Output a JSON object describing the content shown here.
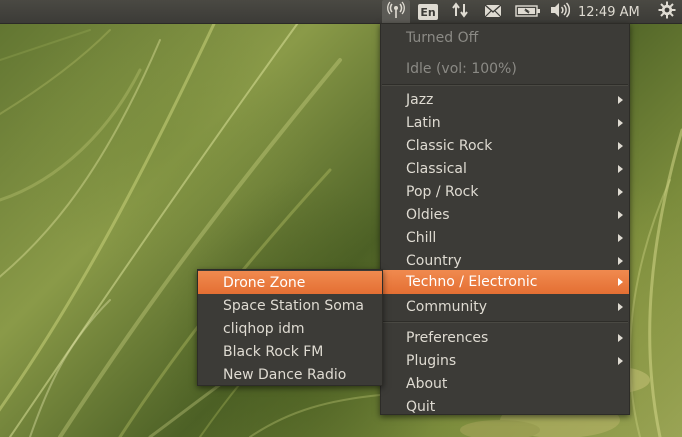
{
  "panel": {
    "language_label": "En",
    "clock": "12:49 AM"
  },
  "radio_menu": {
    "status": "Turned Off",
    "volume_status": "Idle (vol: 100%)",
    "genres": [
      {
        "label": "Jazz",
        "has_submenu": true
      },
      {
        "label": "Latin",
        "has_submenu": true
      },
      {
        "label": "Classic Rock",
        "has_submenu": true
      },
      {
        "label": "Classical",
        "has_submenu": true
      },
      {
        "label": "Pop / Rock",
        "has_submenu": true
      },
      {
        "label": "Oldies",
        "has_submenu": true
      },
      {
        "label": "Chill",
        "has_submenu": true
      },
      {
        "label": "Country",
        "has_submenu": true
      },
      {
        "label": "Techno / Electronic",
        "has_submenu": true,
        "selected": true
      },
      {
        "label": "Community",
        "has_submenu": true
      }
    ],
    "footer": [
      {
        "label": "Preferences",
        "has_submenu": true
      },
      {
        "label": "Plugins",
        "has_submenu": true
      },
      {
        "label": "About",
        "has_submenu": false
      },
      {
        "label": "Quit",
        "has_submenu": false
      }
    ]
  },
  "stations_submenu": {
    "items": [
      {
        "label": "Drone Zone",
        "selected": true
      },
      {
        "label": "Space Station Soma"
      },
      {
        "label": "cliqhop idm"
      },
      {
        "label": "Black Rock FM"
      },
      {
        "label": "New Dance Radio"
      }
    ]
  },
  "colors": {
    "panel": "#3c3b37",
    "menu_bg": "#3c3b37",
    "menu_text": "#dfdbd2",
    "disabled_text": "#8b8a85",
    "highlight": "#e9763b"
  },
  "icons": [
    "radio-tray-icon",
    "keyboard-language-icon",
    "network-icon",
    "mail-icon",
    "battery-icon",
    "volume-icon",
    "session-gear-icon"
  ]
}
